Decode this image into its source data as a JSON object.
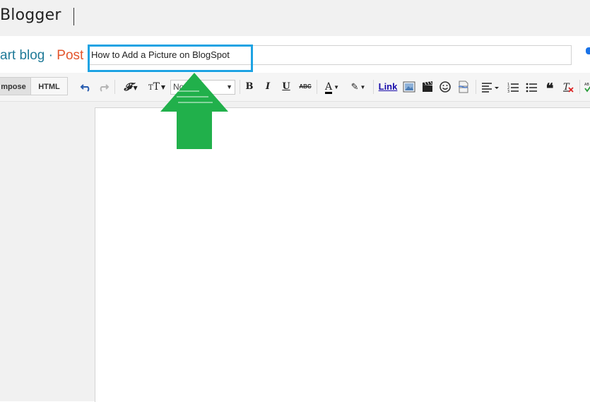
{
  "app": {
    "brand": "Blogger"
  },
  "breadcrumb": {
    "blog": "art blog",
    "separator": "·",
    "current": "Post"
  },
  "post": {
    "title": "How to Add a Picture on BlogSpot"
  },
  "toolbar": {
    "mode_compose": "mpose",
    "mode_html": "HTML",
    "format_value": "Normal",
    "bold": "B",
    "italic": "I",
    "underline": "U",
    "strikethrough": "ABC",
    "text_color": "A",
    "link": "Link",
    "fonts_icon": "font-family-icon",
    "size_icon": "font-size-icon"
  },
  "colors": {
    "highlight_border": "#1ea3e3",
    "arrow": "#21b04b",
    "breadcrumb_blog": "#1f7a98",
    "breadcrumb_post": "#e3552c"
  }
}
